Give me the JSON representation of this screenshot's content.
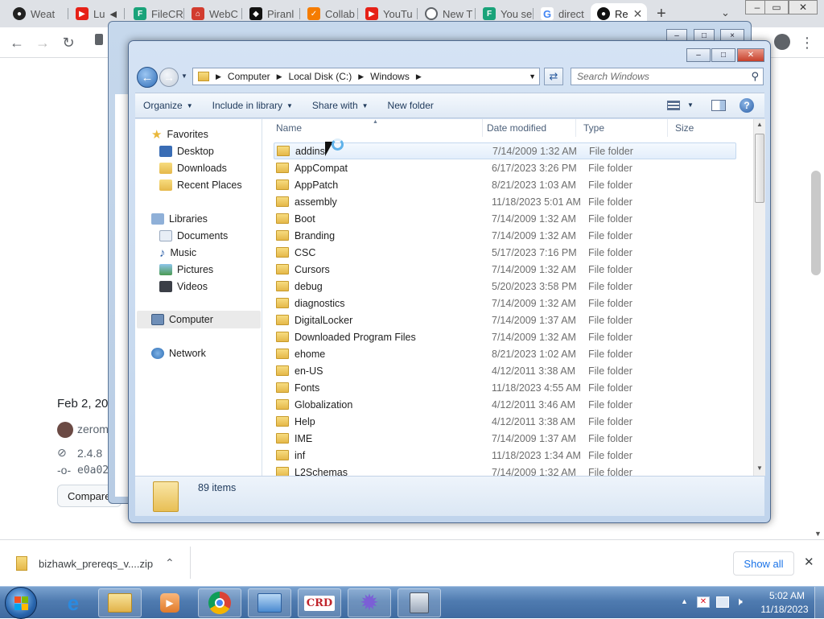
{
  "browser": {
    "tabs": [
      {
        "label": "Weat",
        "icon": "weather-icon",
        "color": "#222222"
      },
      {
        "label": "Lu",
        "icon": "youtube-icon",
        "color": "#e62117"
      },
      {
        "label": "FileCR",
        "icon": "filecr-icon",
        "color": "#1aa37a"
      },
      {
        "label": "WebC",
        "icon": "webc-icon",
        "color": "#d23c2f"
      },
      {
        "label": "Piranl",
        "icon": "piranha-icon",
        "color": "#111111"
      },
      {
        "label": "Collab",
        "icon": "collab-icon",
        "color": "#f57c00"
      },
      {
        "label": "YouTu",
        "icon": "youtube-icon",
        "color": "#e62117"
      },
      {
        "label": "New T",
        "icon": "chrome-icon",
        "color": "#5f6368"
      },
      {
        "label": "You se",
        "icon": "filecr-icon",
        "color": "#1aa37a"
      },
      {
        "label": "direct",
        "icon": "google-icon",
        "color": "#4285f4"
      },
      {
        "label": "Re",
        "icon": "github-icon",
        "color": "#111111"
      }
    ],
    "page_bits": {
      "date": "Feb 2, 20",
      "user": "zerom",
      "tag": "2.4.8",
      "commit": "e0a02",
      "compare": "Compare"
    }
  },
  "explorer_bg": {
    "buttons": [
      "–",
      "□",
      "×"
    ]
  },
  "explorer": {
    "breadcrumb": [
      "Computer",
      "Local Disk (C:)",
      "Windows"
    ],
    "search_placeholder": "Search Windows",
    "commands": {
      "organize": "Organize",
      "include": "Include in library",
      "share": "Share with",
      "newfolder": "New folder"
    },
    "nav": {
      "favorites": "Favorites",
      "desktop": "Desktop",
      "downloads": "Downloads",
      "recent": "Recent Places",
      "libraries": "Libraries",
      "documents": "Documents",
      "music": "Music",
      "pictures": "Pictures",
      "videos": "Videos",
      "computer": "Computer",
      "network": "Network"
    },
    "columns": {
      "name": "Name",
      "date": "Date modified",
      "type": "Type",
      "size": "Size"
    },
    "files": [
      {
        "name": "addins",
        "date": "7/14/2009 1:32 AM",
        "type": "File folder"
      },
      {
        "name": "AppCompat",
        "date": "6/17/2023 3:26 PM",
        "type": "File folder"
      },
      {
        "name": "AppPatch",
        "date": "8/21/2023 1:03 AM",
        "type": "File folder"
      },
      {
        "name": "assembly",
        "date": "11/18/2023 5:01 AM",
        "type": "File folder"
      },
      {
        "name": "Boot",
        "date": "7/14/2009 1:32 AM",
        "type": "File folder"
      },
      {
        "name": "Branding",
        "date": "7/14/2009 1:32 AM",
        "type": "File folder"
      },
      {
        "name": "CSC",
        "date": "5/17/2023 7:16 PM",
        "type": "File folder"
      },
      {
        "name": "Cursors",
        "date": "7/14/2009 1:32 AM",
        "type": "File folder"
      },
      {
        "name": "debug",
        "date": "5/20/2023 3:58 PM",
        "type": "File folder"
      },
      {
        "name": "diagnostics",
        "date": "7/14/2009 1:32 AM",
        "type": "File folder"
      },
      {
        "name": "DigitalLocker",
        "date": "7/14/2009 1:37 AM",
        "type": "File folder"
      },
      {
        "name": "Downloaded Program Files",
        "date": "7/14/2009 1:32 AM",
        "type": "File folder"
      },
      {
        "name": "ehome",
        "date": "8/21/2023 1:02 AM",
        "type": "File folder"
      },
      {
        "name": "en-US",
        "date": "4/12/2011 3:38 AM",
        "type": "File folder"
      },
      {
        "name": "Fonts",
        "date": "11/18/2023 4:55 AM",
        "type": "File folder"
      },
      {
        "name": "Globalization",
        "date": "4/12/2011 3:46 AM",
        "type": "File folder"
      },
      {
        "name": "Help",
        "date": "4/12/2011 3:38 AM",
        "type": "File folder"
      },
      {
        "name": "IME",
        "date": "7/14/2009 1:37 AM",
        "type": "File folder"
      },
      {
        "name": "inf",
        "date": "11/18/2023 1:34 AM",
        "type": "File folder"
      },
      {
        "name": "L2Schemas",
        "date": "7/14/2009 1:32 AM",
        "type": "File folder"
      }
    ],
    "item_count": "89 items"
  },
  "downloads": {
    "file": "bizhawk_prereqs_v....zip",
    "show_all": "Show all"
  },
  "taskbar": {
    "time": "5:02 AM",
    "date": "11/18/2023",
    "apps": [
      "ie-icon",
      "explorer-icon",
      "media-player-icon",
      "chrome-icon",
      "control-panel-icon",
      "crd-icon",
      "snowflake-app-icon",
      "rufus-icon"
    ],
    "crd_label": "CRD"
  }
}
